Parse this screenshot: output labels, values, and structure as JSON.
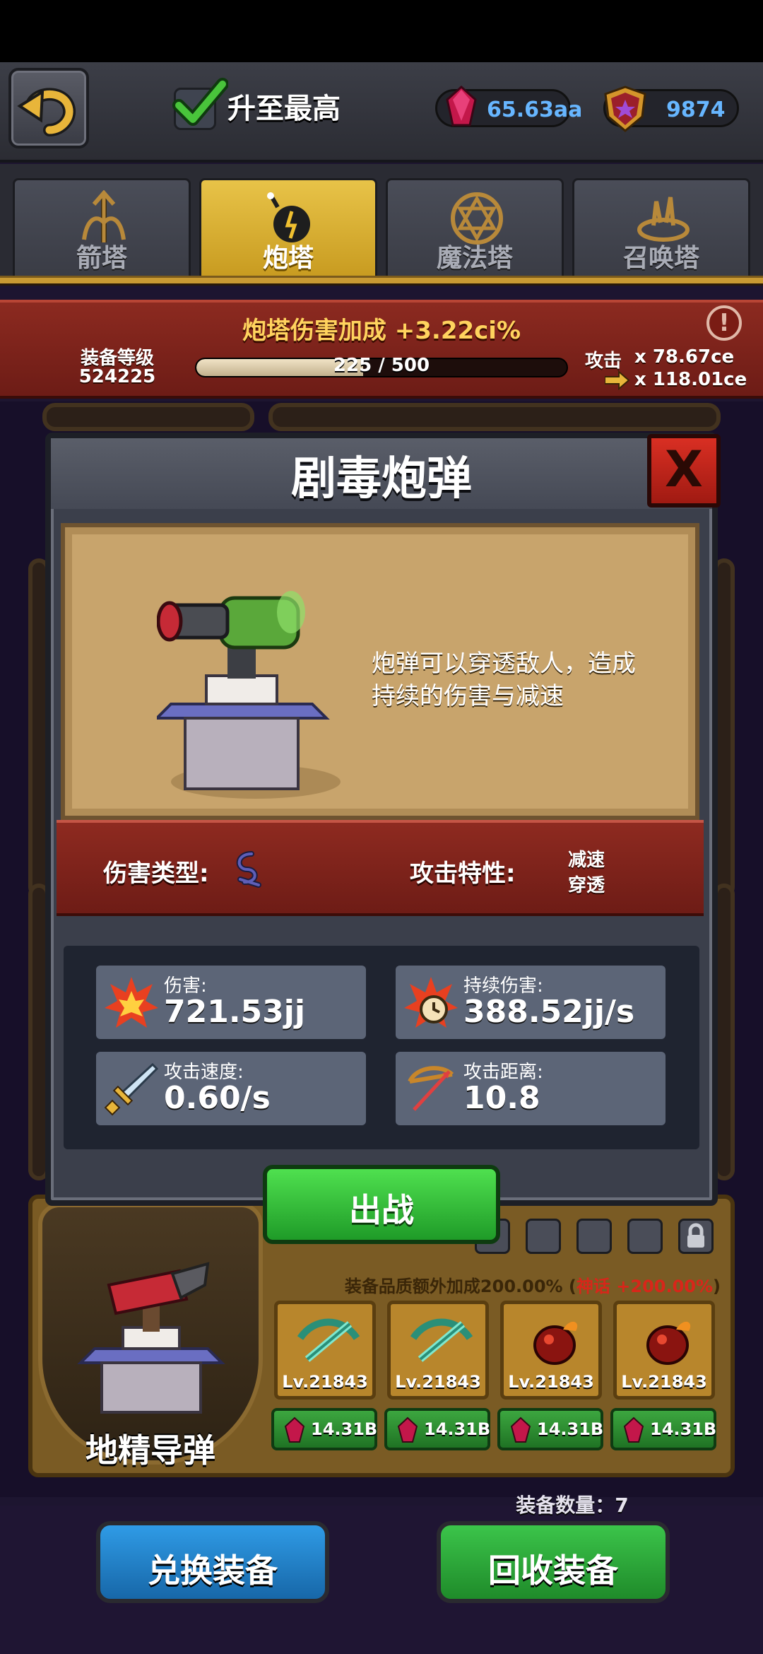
{
  "topbar": {
    "check_label": "升至最高",
    "gems": "65.63aa",
    "medals": "9874"
  },
  "tabs": [
    {
      "label": "箭塔",
      "icon": "arrow-tower-icon"
    },
    {
      "label": "炮塔",
      "icon": "bomb-tower-icon",
      "active": true
    },
    {
      "label": "魔法塔",
      "icon": "hexagram-icon"
    },
    {
      "label": "召唤塔",
      "icon": "summon-portal-icon"
    }
  ],
  "banner": {
    "bonus_label": "炮塔伤害加成",
    "bonus_value": "+3.22ci%",
    "equip_level_label": "装备等级",
    "equip_level_value": "524225",
    "progress_text": "225 / 500",
    "progress_fraction": 0.45,
    "attack_label": "攻击",
    "attack_value": "x 78.67ce",
    "attack_next": "x 118.01ce"
  },
  "modal": {
    "title": "剧毒炮弹",
    "close_label": "X",
    "description": "炮弹可以穿透敌人，造成持续的伤害与减速",
    "damage_type_label": "伤害类型:",
    "attack_trait_label": "攻击特性:",
    "traits": [
      "减速",
      "穿透"
    ],
    "stats": [
      {
        "label": "伤害:",
        "value": "721.53jj",
        "icon": "fire-burst-icon"
      },
      {
        "label": "持续伤害:",
        "value": "388.52jj/s",
        "icon": "fire-clock-icon"
      },
      {
        "label": "攻击速度:",
        "value": "0.60/s",
        "icon": "sword-icon"
      },
      {
        "label": "攻击距离:",
        "value": "10.8",
        "icon": "bow-icon"
      }
    ],
    "deploy_label": "出战"
  },
  "tower_panel": {
    "name": "地精导弹",
    "quality_note_prefix": "装备品质额外加成200.00% (",
    "quality_note_red": "神话 +200.00%",
    "quality_note_suffix": ")",
    "equipment": [
      {
        "level": "Lv.21843",
        "price": "14.31B",
        "icon": "crossbow-icon"
      },
      {
        "level": "Lv.21843",
        "price": "14.31B",
        "icon": "crossbow-icon"
      },
      {
        "level": "Lv.21843",
        "price": "14.31B",
        "icon": "fire-bomb-icon"
      },
      {
        "level": "Lv.21843",
        "price": "14.31B",
        "icon": "fire-bomb-icon"
      }
    ]
  },
  "footer": {
    "count_text": "装备数量：7",
    "exchange_label": "兑换装备",
    "recycle_label": "回收装备"
  },
  "colors": {
    "gem_text": "#67b6ff",
    "bonus_text": "#ffd35e",
    "active_tab": "#e8c348",
    "deploy_green": "#2fbf38",
    "exchange_blue": "#1d7fc9",
    "recycle_green": "#2a9d35",
    "mythic_red": "#d8261a"
  }
}
